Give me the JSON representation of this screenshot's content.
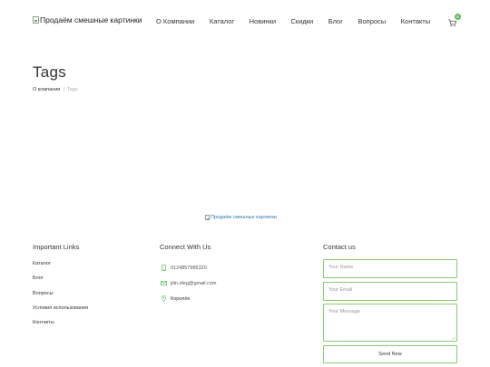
{
  "header": {
    "logo_alt": "Продаём смешные картинки",
    "nav": [
      "О Компании",
      "Каталог",
      "Новинки",
      "Скидки",
      "Блог",
      "Вопросы",
      "Контакты"
    ],
    "cart_count": "0",
    "accent_color": "#5cb85c"
  },
  "page": {
    "title": "Tags",
    "breadcrumb": {
      "home": "О компании",
      "separator": "/",
      "current": "Tags"
    }
  },
  "footer": {
    "logo_alt": "Продаём смешные картинки",
    "important_links": {
      "title": "Important Links",
      "items": [
        "Каталог",
        "Блог",
        "Вопросы",
        "Условия использования",
        "Контакты"
      ]
    },
    "connect": {
      "title": "Connect With Us",
      "phone": "0124857985320",
      "email": "jilin.oleg@gmail.com",
      "city": "Коропёе",
      "icons": [
        "phone-icon",
        "mail-icon",
        "location-pin-icon"
      ]
    },
    "contact_form": {
      "title": "Contact us",
      "name_placeholder": "Your Name",
      "email_placeholder": "Your Email",
      "message_placeholder": "Your Message",
      "send_label": "Send Now",
      "border_color": "#8cc971"
    }
  }
}
